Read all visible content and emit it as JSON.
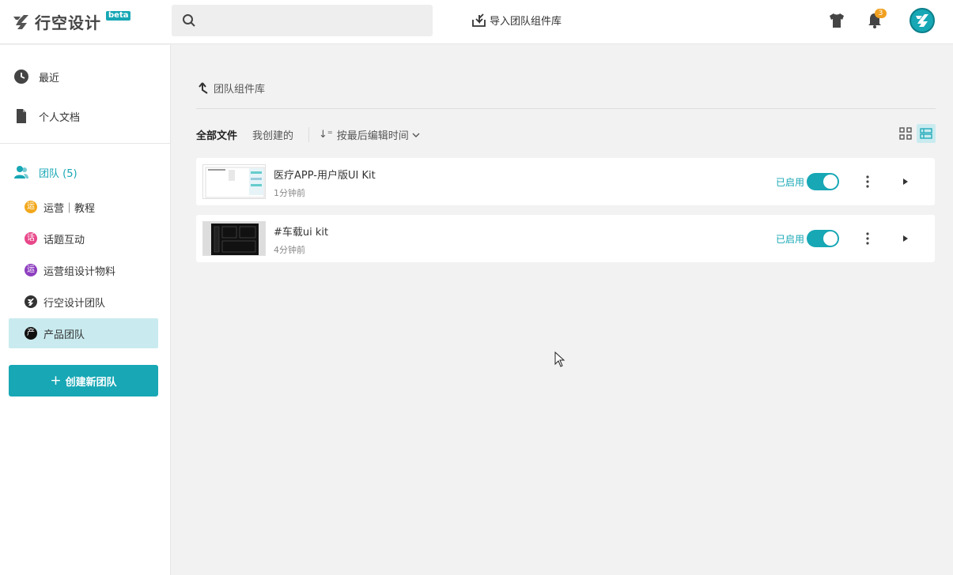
{
  "header": {
    "logo_text": "行空设计",
    "beta": "beta",
    "search_placeholder": "",
    "import_label": "导入团队组件库",
    "notification_count": "3"
  },
  "sidebar": {
    "recent": "最近",
    "personal": "个人文档",
    "team_header": "团队 (5)",
    "teams": [
      {
        "badge": "运",
        "label": "运营｜教程",
        "color": "#f2a81d"
      },
      {
        "badge": "话",
        "label": "话题互动",
        "color": "#e8488a"
      },
      {
        "badge": "运",
        "label": "运营组设计物料",
        "color": "#8e3fbf"
      },
      {
        "badge": "",
        "label": "行空设计团队",
        "color": "#333333"
      },
      {
        "badge": "产",
        "label": "产品团队",
        "color": "#111111"
      }
    ],
    "create_team": "创建新团队"
  },
  "main": {
    "back_label": "团队组件库",
    "tabs": [
      "全部文件",
      "我创建的"
    ],
    "sort_label": "按最后编辑时间",
    "files": [
      {
        "name": "医疗APP-用户版UI Kit",
        "time": "1分钟前",
        "status": "已启用"
      },
      {
        "name": "#车载ui kit",
        "time": "4分钟前",
        "status": "已启用"
      }
    ]
  },
  "colors": {
    "accent": "#17a7b5",
    "active_bg": "#c9ebef",
    "badge": "#f0a020"
  }
}
